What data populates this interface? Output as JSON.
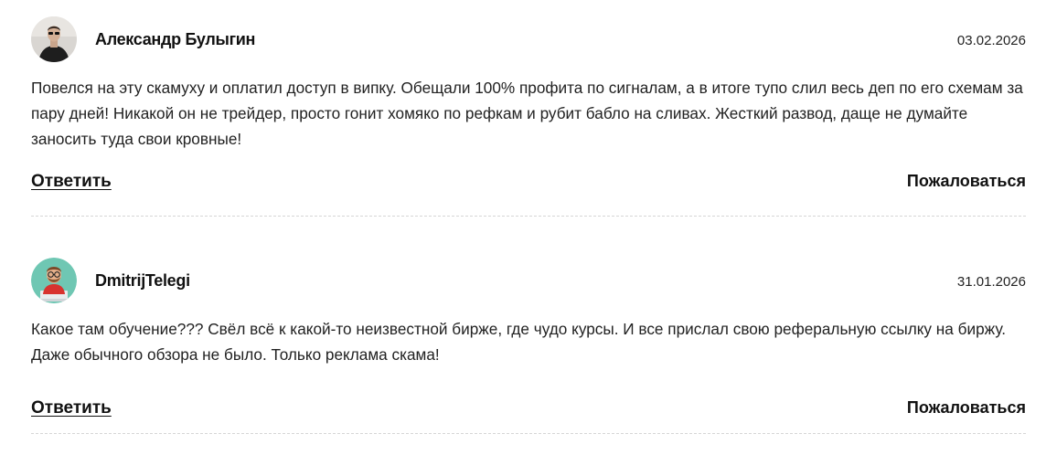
{
  "comments": [
    {
      "author": "Александр Булыгин",
      "date": "03.02.2026",
      "text": "Повелся на эту скамуху и оплатил доступ в випку. Обещали 100% профита по сигналам, а в итоге тупо слил весь деп по его схемам за пару дней! Никакой он не трейдер, просто гонит хомяко по рефкам и рубит бабло на сливах. Жесткий развод, даще не думайте заносить туда свои кровные!",
      "reply_label": "Ответить",
      "report_label": "Пожаловаться"
    },
    {
      "author": "DmitrijTelegi",
      "date": "31.01.2026",
      "text": "Какое там обучение??? Свёл всё к какой-то неизвестной бирже, где чудо курсы. И все прислал свою реферальную ссылку на биржу. Даже обычного обзора не было. Только реклама скама!",
      "reply_label": "Ответить",
      "report_label": "Пожаловаться"
    }
  ],
  "colors": {
    "text": "#222222",
    "divider": "#d6d6d6",
    "avatar2_bg": "#6fc7b3"
  }
}
